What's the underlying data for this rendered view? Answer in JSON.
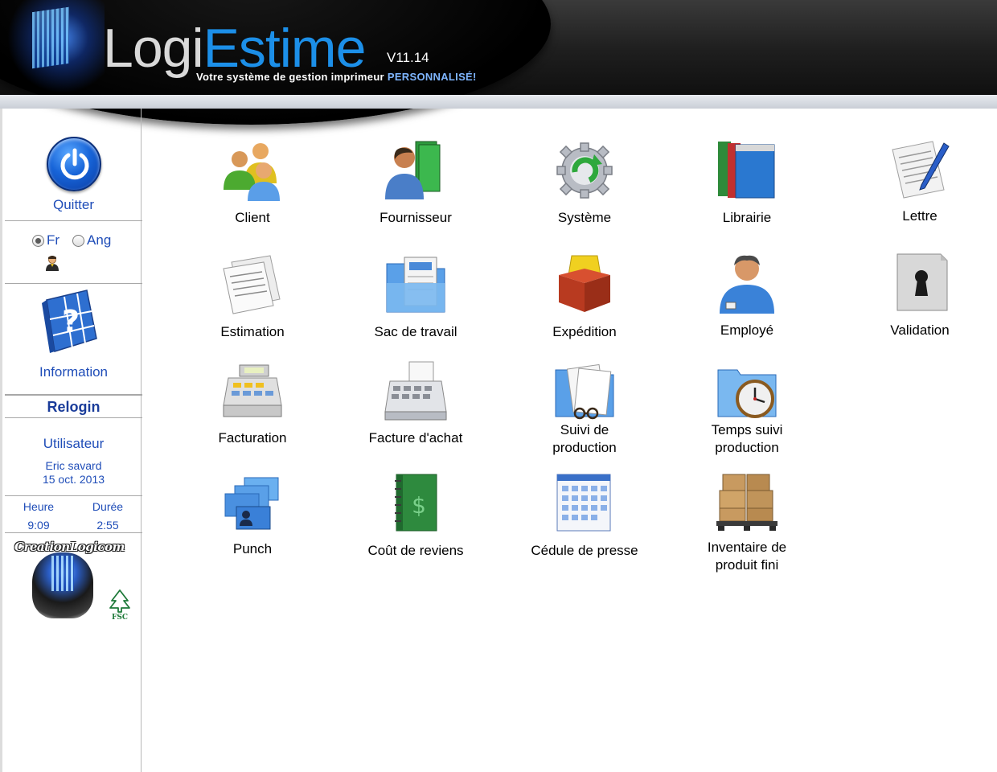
{
  "header": {
    "title_part1": "Logi",
    "title_part2": "Estime",
    "version": "V11.14",
    "tagline": "Votre système de gestion imprimeur",
    "tagline_accent": "PERSONNALISÉ!"
  },
  "sidebar": {
    "quit_label": "Quitter",
    "lang_fr": "Fr",
    "lang_en": "Ang",
    "info_label": "Information",
    "relogin_label": "Relogin",
    "user_label": "Utilisateur",
    "user_name": "Eric savard",
    "date": "15 oct. 2013",
    "time_label": "Heure",
    "duration_label": "Durée",
    "time_value": "9:09",
    "duration_value": "2:55",
    "brand_text": "CreationLogicom",
    "fsc_text": "FSC"
  },
  "modules": {
    "client": "Client",
    "fournisseur": "Fournisseur",
    "systeme": "Système",
    "librairie": "Librairie",
    "lettre": "Lettre",
    "estimation": "Estimation",
    "sac_de_travail": "Sac de travail",
    "expedition": "Expédition",
    "employe": "Employé",
    "validation": "Validation",
    "facturation": "Facturation",
    "facture_achat": "Facture d'achat",
    "suivi_production_1": "Suivi de",
    "suivi_production_2": "production",
    "temps_suivi_1": "Temps suivi",
    "temps_suivi_2": "production",
    "punch": "Punch",
    "cout_de_reviens": "Coût de reviens",
    "cedule_de_presse": "Cédule de presse",
    "inventaire_1": "Inventaire de",
    "inventaire_2": "produit fini"
  },
  "colors": {
    "link_blue": "#1f4db8",
    "accent_blue": "#1c8fe8"
  }
}
